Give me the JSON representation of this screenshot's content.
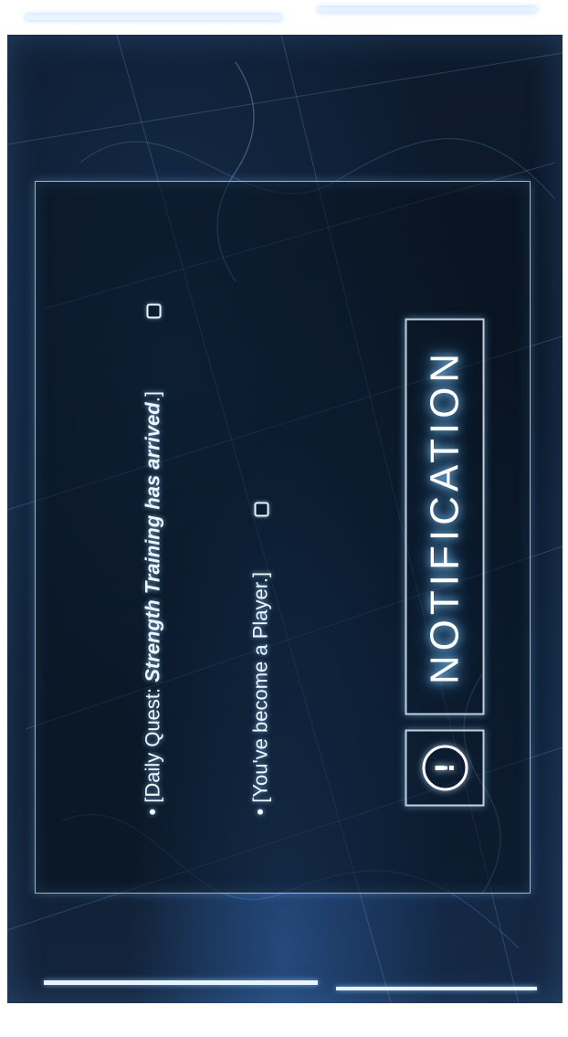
{
  "header": {
    "title": "NOTIFICATION",
    "alert_icon": "exclamation-circle-icon",
    "alert_glyph": "!"
  },
  "messages": [
    {
      "bullet": "•",
      "text": "[You've become a Player.]",
      "checkbox_icon": "checkbox-empty-icon"
    },
    {
      "bullet": "•",
      "prefix": "[Daily Quest: ",
      "quest_name": "Strength Training has arrived",
      "suffix": ".]",
      "checkbox_icon": "checkbox-empty-icon"
    }
  ],
  "colors": {
    "panel_border": "#d2e6f5",
    "glow": "#8fd1ff",
    "background": "#0b1626"
  }
}
